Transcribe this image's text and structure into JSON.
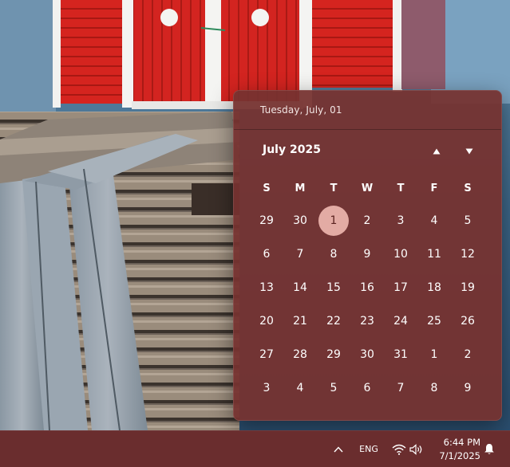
{
  "calendar": {
    "selected_date_label": "Tuesday, July, 01",
    "month_label": "July 2025",
    "weekdays": [
      "S",
      "M",
      "T",
      "W",
      "T",
      "F",
      "S"
    ],
    "today": "1",
    "weeks": [
      [
        "29",
        "30",
        "1",
        "2",
        "3",
        "4",
        "5"
      ],
      [
        "6",
        "7",
        "8",
        "9",
        "10",
        "11",
        "12"
      ],
      [
        "13",
        "14",
        "15",
        "16",
        "17",
        "18",
        "19"
      ],
      [
        "20",
        "21",
        "22",
        "23",
        "24",
        "25",
        "26"
      ],
      [
        "27",
        "28",
        "29",
        "30",
        "31",
        "1",
        "2"
      ],
      [
        "3",
        "4",
        "5",
        "6",
        "7",
        "8",
        "9"
      ]
    ],
    "nav_up_icon": "triangle-up-icon",
    "nav_down_icon": "triangle-down-icon"
  },
  "taskbar": {
    "chevron_icon": "chevron-up-icon",
    "language": "ENG",
    "wifi_icon": "wifi-icon",
    "volume_icon": "volume-icon",
    "time": "6:44 PM",
    "date": "7/1/2025",
    "notification_icon": "bell-icon"
  },
  "colors": {
    "flyout_bg": "#763230",
    "today_highlight": "#e3aba4",
    "taskbar_bg": "#6a2d2e"
  }
}
